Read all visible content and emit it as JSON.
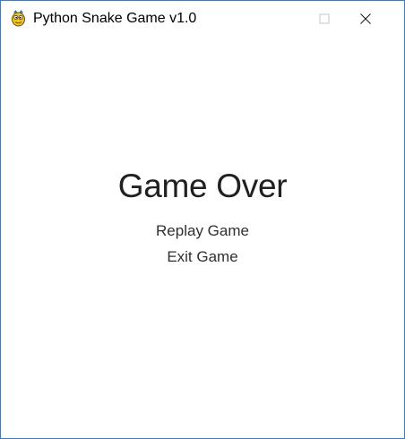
{
  "window": {
    "title": "Python Snake Game v1.0",
    "app_icon": "pygame-snake-icon",
    "controls": {
      "minimize_icon": "minimize-icon",
      "maximize_icon": "maximize-icon",
      "close_icon": "close-icon"
    },
    "accent_color": "#2b7fd6"
  },
  "game_over": {
    "heading": "Game Over",
    "menu": [
      {
        "label": "Replay Game"
      },
      {
        "label": "Exit Game"
      }
    ]
  }
}
